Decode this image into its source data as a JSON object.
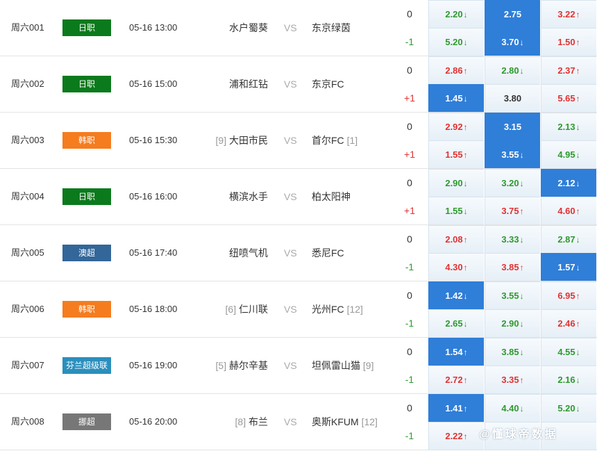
{
  "colors": {
    "jleague": "#0b7a1c",
    "kleague": "#f57c1f",
    "aleague": "#336699",
    "finland": "#2a8fbd",
    "norway": "#777777",
    "selected": "#2f7ed8",
    "up": "#e13232",
    "down": "#2e9a2e"
  },
  "vs_text": "VS",
  "watermark": "@懂球帝数据",
  "matches": [
    {
      "id": "周六001",
      "league": "日职",
      "league_color": "#0b7a1c",
      "time": "05-16 13:00",
      "home": "水户蜀葵",
      "home_rank": "",
      "away": "东京绿茵",
      "away_rank": "",
      "lines": [
        {
          "hc": "0",
          "odds": [
            {
              "v": "2.20",
              "t": "down",
              "sel": false
            },
            {
              "v": "2.75",
              "t": "flat",
              "sel": true
            },
            {
              "v": "3.22",
              "t": "up",
              "sel": false
            }
          ]
        },
        {
          "hc": "-1",
          "odds": [
            {
              "v": "5.20",
              "t": "down",
              "sel": false
            },
            {
              "v": "3.70",
              "t": "down",
              "sel": true
            },
            {
              "v": "1.50",
              "t": "up",
              "sel": false
            }
          ]
        }
      ]
    },
    {
      "id": "周六002",
      "league": "日职",
      "league_color": "#0b7a1c",
      "time": "05-16 15:00",
      "home": "浦和红钻",
      "home_rank": "",
      "away": "东京FC",
      "away_rank": "",
      "lines": [
        {
          "hc": "0",
          "odds": [
            {
              "v": "2.86",
              "t": "up",
              "sel": false
            },
            {
              "v": "2.80",
              "t": "down",
              "sel": false
            },
            {
              "v": "2.37",
              "t": "up",
              "sel": false
            }
          ]
        },
        {
          "hc": "+1",
          "odds": [
            {
              "v": "1.45",
              "t": "down",
              "sel": true
            },
            {
              "v": "3.80",
              "t": "flat",
              "sel": false
            },
            {
              "v": "5.65",
              "t": "up",
              "sel": false
            }
          ]
        }
      ]
    },
    {
      "id": "周六003",
      "league": "韩职",
      "league_color": "#f57c1f",
      "time": "05-16 15:30",
      "home": "大田市民",
      "home_rank": "[9]",
      "away": "首尔FC",
      "away_rank": "[1]",
      "lines": [
        {
          "hc": "0",
          "odds": [
            {
              "v": "2.92",
              "t": "up",
              "sel": false
            },
            {
              "v": "3.15",
              "t": "flat",
              "sel": true
            },
            {
              "v": "2.13",
              "t": "down",
              "sel": false
            }
          ]
        },
        {
          "hc": "+1",
          "odds": [
            {
              "v": "1.55",
              "t": "up",
              "sel": false
            },
            {
              "v": "3.55",
              "t": "down",
              "sel": true
            },
            {
              "v": "4.95",
              "t": "down",
              "sel": false
            }
          ]
        }
      ]
    },
    {
      "id": "周六004",
      "league": "日职",
      "league_color": "#0b7a1c",
      "time": "05-16 16:00",
      "home": "横滨水手",
      "home_rank": "",
      "away": "柏太阳神",
      "away_rank": "",
      "lines": [
        {
          "hc": "0",
          "odds": [
            {
              "v": "2.90",
              "t": "down",
              "sel": false
            },
            {
              "v": "3.20",
              "t": "down",
              "sel": false
            },
            {
              "v": "2.12",
              "t": "down",
              "sel": true
            }
          ]
        },
        {
          "hc": "+1",
          "odds": [
            {
              "v": "1.55",
              "t": "down",
              "sel": false
            },
            {
              "v": "3.75",
              "t": "up",
              "sel": false
            },
            {
              "v": "4.60",
              "t": "up",
              "sel": false
            }
          ]
        }
      ]
    },
    {
      "id": "周六005",
      "league": "澳超",
      "league_color": "#336699",
      "time": "05-16 17:40",
      "home": "纽喷气机",
      "home_rank": "",
      "away": "悉尼FC",
      "away_rank": "",
      "lines": [
        {
          "hc": "0",
          "odds": [
            {
              "v": "2.08",
              "t": "up",
              "sel": false
            },
            {
              "v": "3.33",
              "t": "down",
              "sel": false
            },
            {
              "v": "2.87",
              "t": "down",
              "sel": false
            }
          ]
        },
        {
          "hc": "-1",
          "odds": [
            {
              "v": "4.30",
              "t": "up",
              "sel": false
            },
            {
              "v": "3.85",
              "t": "up",
              "sel": false
            },
            {
              "v": "1.57",
              "t": "down",
              "sel": true
            }
          ]
        }
      ]
    },
    {
      "id": "周六006",
      "league": "韩职",
      "league_color": "#f57c1f",
      "time": "05-16 18:00",
      "home": "仁川联",
      "home_rank": "[6]",
      "away": "光州FC",
      "away_rank": "[12]",
      "lines": [
        {
          "hc": "0",
          "odds": [
            {
              "v": "1.42",
              "t": "down",
              "sel": true
            },
            {
              "v": "3.55",
              "t": "down",
              "sel": false
            },
            {
              "v": "6.95",
              "t": "up",
              "sel": false
            }
          ]
        },
        {
          "hc": "-1",
          "odds": [
            {
              "v": "2.65",
              "t": "down",
              "sel": false
            },
            {
              "v": "2.90",
              "t": "down",
              "sel": false
            },
            {
              "v": "2.46",
              "t": "up",
              "sel": false
            }
          ]
        }
      ]
    },
    {
      "id": "周六007",
      "league": "芬兰超级联",
      "league_color": "#2a8fbd",
      "time": "05-16 19:00",
      "home": "赫尔辛基",
      "home_rank": "[5]",
      "away": "坦佩雷山猫",
      "away_rank": "[9]",
      "lines": [
        {
          "hc": "0",
          "odds": [
            {
              "v": "1.54",
              "t": "up",
              "sel": true
            },
            {
              "v": "3.85",
              "t": "down",
              "sel": false
            },
            {
              "v": "4.55",
              "t": "down",
              "sel": false
            }
          ]
        },
        {
          "hc": "-1",
          "odds": [
            {
              "v": "2.72",
              "t": "up",
              "sel": false
            },
            {
              "v": "3.35",
              "t": "up",
              "sel": false
            },
            {
              "v": "2.16",
              "t": "down",
              "sel": false
            }
          ]
        }
      ]
    },
    {
      "id": "周六008",
      "league": "挪超",
      "league_color": "#777777",
      "time": "05-16 20:00",
      "home": "布兰",
      "home_rank": "[8]",
      "away": "奥斯KFUM",
      "away_rank": "[12]",
      "lines": [
        {
          "hc": "0",
          "odds": [
            {
              "v": "1.41",
              "t": "up",
              "sel": true
            },
            {
              "v": "4.40",
              "t": "down",
              "sel": false
            },
            {
              "v": "5.20",
              "t": "down",
              "sel": false
            }
          ]
        },
        {
          "hc": "-1",
          "odds": [
            {
              "v": "2.22",
              "t": "up",
              "sel": false
            },
            {
              "v": "",
              "t": "flat",
              "sel": false
            },
            {
              "v": "",
              "t": "flat",
              "sel": false
            }
          ]
        }
      ]
    }
  ]
}
